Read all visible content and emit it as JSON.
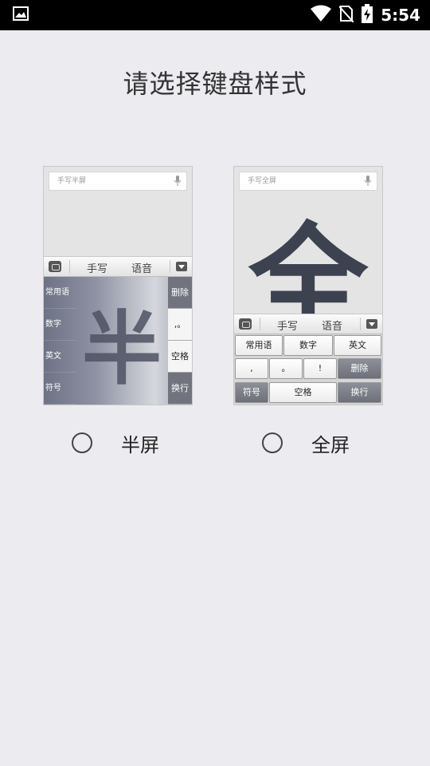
{
  "status_bar": {
    "time": "5:54",
    "icons": [
      "image-icon",
      "wifi-icon",
      "no-sim-icon",
      "battery-charging-icon"
    ]
  },
  "title": "请选择键盘样式",
  "half_preview": {
    "search_placeholder": "手写半屏",
    "toolbar": {
      "handwrite": "手写",
      "voice": "语音"
    },
    "left_keys": [
      "常用语",
      "数字",
      "英文",
      "符号"
    ],
    "right_keys": [
      "删除",
      ",。",
      "空格",
      "换行"
    ],
    "glyph": "半"
  },
  "full_preview": {
    "search_placeholder": "手写全屏",
    "toolbar": {
      "handwrite": "手写",
      "voice": "语音"
    },
    "glyph": "全",
    "row1": [
      "常用语",
      "数字",
      "英文"
    ],
    "row2": [
      ",",
      "。",
      "!",
      "删除"
    ],
    "row3": [
      "符号",
      "空格",
      "换行"
    ]
  },
  "options": {
    "half_label": "半屏",
    "full_label": "全屏"
  }
}
